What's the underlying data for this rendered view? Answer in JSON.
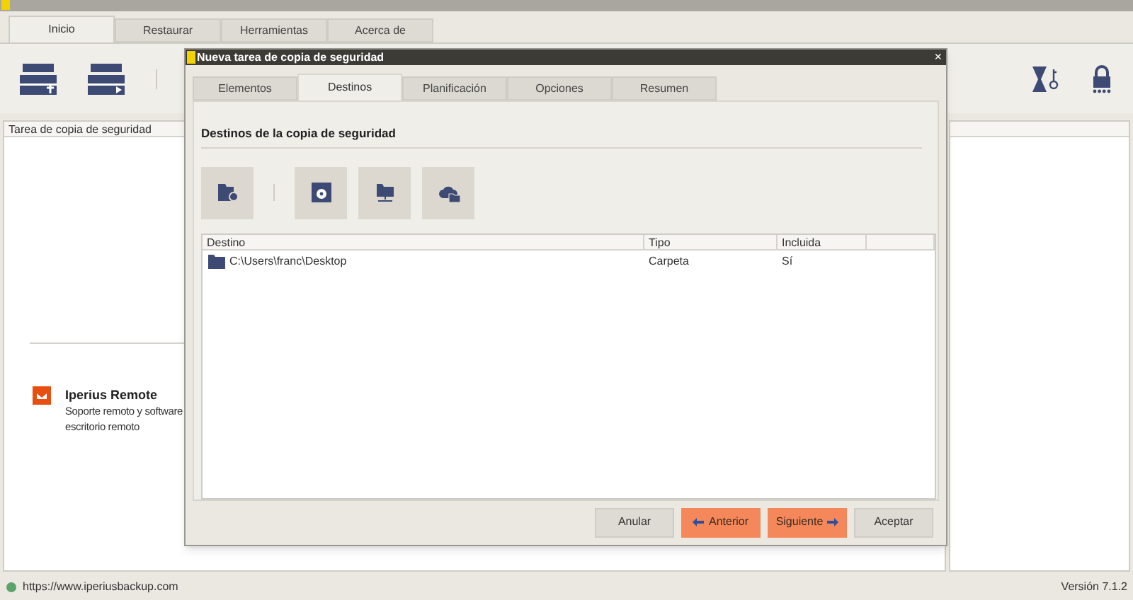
{
  "main_window": {
    "tabs": [
      {
        "label": "Inicio",
        "selected": true
      },
      {
        "label": "Restaurar",
        "selected": false
      },
      {
        "label": "Herramientas",
        "selected": false
      },
      {
        "label": "Acerca de",
        "selected": false
      }
    ],
    "left_panel": {
      "header": "Tarea de copia de seguridad",
      "promo": {
        "title": "Iperius Remote",
        "description": [
          "Soporte remoto y software",
          "escritorio remoto"
        ]
      }
    },
    "status_bar": {
      "url": "https://www.iperiusbackup.com",
      "version": "Versión 7.1.2"
    }
  },
  "dialog": {
    "title": "Nueva tarea de copia de seguridad",
    "close": "×",
    "tabs": [
      {
        "label": "Elementos",
        "selected": false
      },
      {
        "label": "Destinos",
        "selected": true
      },
      {
        "label": "Planificación",
        "selected": false
      },
      {
        "label": "Opciones",
        "selected": false
      },
      {
        "label": "Resumen",
        "selected": false
      }
    ],
    "section_title": "Destinos de la copia de seguridad",
    "table": {
      "columns": [
        "Destino",
        "Tipo",
        "Incluida"
      ],
      "rows": [
        {
          "cells": [
            "C:\\Users\\franc\\Desktop",
            "Carpeta",
            "Sí"
          ]
        }
      ]
    },
    "buttons": [
      {
        "label": "Anular",
        "kind": "normal"
      },
      {
        "label": "Anterior",
        "kind": "back"
      },
      {
        "label": "Siguiente",
        "kind": "next"
      },
      {
        "label": "Aceptar",
        "kind": "normal"
      }
    ]
  }
}
